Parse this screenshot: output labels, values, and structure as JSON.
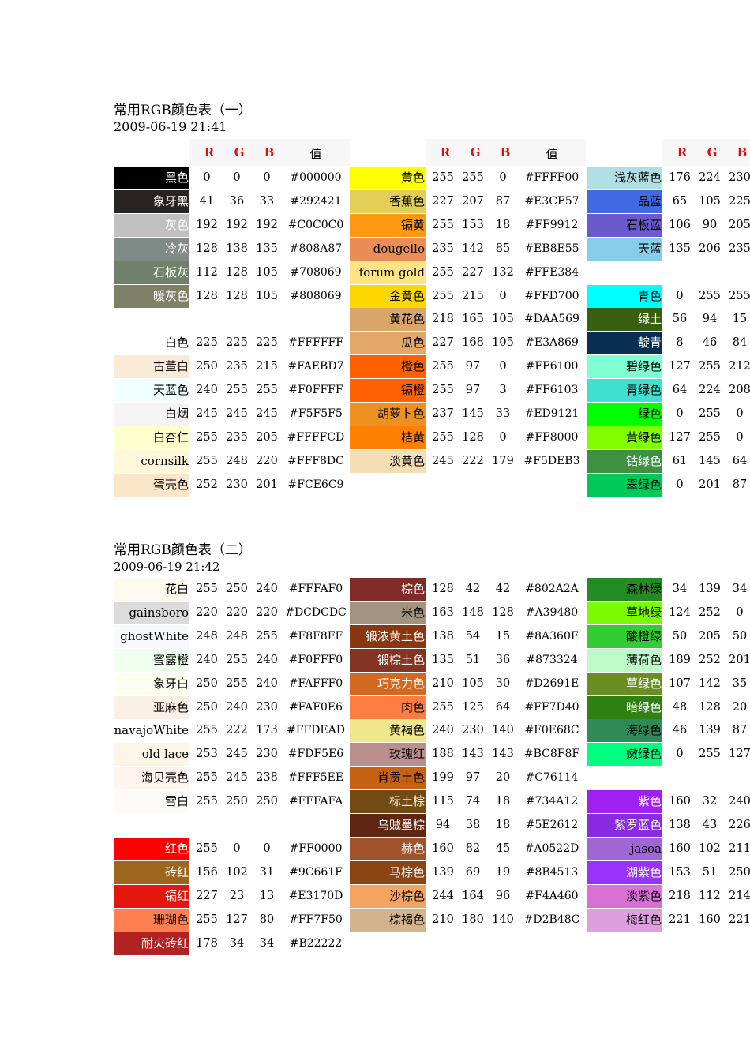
{
  "section1": {
    "title": "常用RGB颜色表（一）",
    "date": "2009-06-19 21:41",
    "header": {
      "r": "R",
      "g": "G",
      "b": "B",
      "value": "值"
    },
    "columns": [
      [
        {
          "name": "黑色",
          "r": "0",
          "g": "0",
          "b": "0",
          "hex": "#000000",
          "color": "#000000",
          "text": "#ffffff"
        },
        {
          "name": "象牙黑",
          "r": "41",
          "g": "36",
          "b": "33",
          "hex": "#292421",
          "color": "#292421",
          "text": "#ffffff"
        },
        {
          "name": "灰色",
          "r": "192",
          "g": "192",
          "b": "192",
          "hex": "#C0C0C0",
          "color": "#C0C0C0",
          "text": "#ffffff"
        },
        {
          "name": "冷灰",
          "r": "128",
          "g": "138",
          "b": "135",
          "hex": "#808A87",
          "color": "#808A87",
          "text": "#ffffff"
        },
        {
          "name": "石板灰",
          "r": "112",
          "g": "128",
          "b": "105",
          "hex": "#708069",
          "color": "#708069",
          "text": "#ffffff"
        },
        {
          "name": "暖灰色",
          "r": "128",
          "g": "128",
          "b": "105",
          "hex": "#808069",
          "color": "#808069",
          "text": "#ffffff"
        },
        null,
        {
          "name": "白色",
          "r": "225",
          "g": "225",
          "b": "225",
          "hex": "#FFFFFF",
          "color": "#FFFFFF",
          "text": "#000000"
        },
        {
          "name": "古董白",
          "r": "250",
          "g": "235",
          "b": "215",
          "hex": "#FAEBD7",
          "color": "#FAEBD7",
          "text": "#000000"
        },
        {
          "name": "天蓝色",
          "r": "240",
          "g": "255",
          "b": "255",
          "hex": "#F0FFFF",
          "color": "#F0FFFF",
          "text": "#000000"
        },
        {
          "name": "白烟",
          "r": "245",
          "g": "245",
          "b": "245",
          "hex": "#F5F5F5",
          "color": "#F5F5F5",
          "text": "#000000"
        },
        {
          "name": "白杏仁",
          "r": "255",
          "g": "235",
          "b": "205",
          "hex": "#FFFFCD",
          "color": "#FFFFCD",
          "text": "#000000"
        },
        {
          "name": "cornsilk",
          "r": "255",
          "g": "248",
          "b": "220",
          "hex": "#FFF8DC",
          "color": "#FFF8DC",
          "text": "#000000"
        },
        {
          "name": "蛋壳色",
          "r": "252",
          "g": "230",
          "b": "201",
          "hex": "#FCE6C9",
          "color": "#FCE6C9",
          "text": "#000000"
        }
      ],
      [
        {
          "name": "黄色",
          "r": "255",
          "g": "255",
          "b": "0",
          "hex": "#FFFF00",
          "color": "#FFFF00",
          "text": "#000000"
        },
        {
          "name": "香蕉色",
          "r": "227",
          "g": "207",
          "b": "87",
          "hex": "#E3CF57",
          "color": "#E3CF57",
          "text": "#000000"
        },
        {
          "name": "镉黄",
          "r": "255",
          "g": "153",
          "b": "18",
          "hex": "#FF9912",
          "color": "#FF9912",
          "text": "#000000"
        },
        {
          "name": "dougello",
          "r": "235",
          "g": "142",
          "b": "85",
          "hex": "#EB8E55",
          "color": "#EB8E55",
          "text": "#000000"
        },
        {
          "name": "forum gold",
          "r": "255",
          "g": "227",
          "b": "132",
          "hex": "#FFE384",
          "color": "#FFE384",
          "text": "#000000"
        },
        {
          "name": "金黄色",
          "r": "255",
          "g": "215",
          "b": "0",
          "hex": "#FFD700",
          "color": "#FFD700",
          "text": "#000000"
        },
        {
          "name": "黄花色",
          "r": "218",
          "g": "165",
          "b": "105",
          "hex": "#DAA569",
          "color": "#DAA569",
          "text": "#000000"
        },
        {
          "name": "瓜色",
          "r": "227",
          "g": "168",
          "b": "105",
          "hex": "#E3A869",
          "color": "#E3A869",
          "text": "#000000"
        },
        {
          "name": "橙色",
          "r": "255",
          "g": "97",
          "b": "0",
          "hex": "#FF6100",
          "color": "#FF6100",
          "text": "#000000"
        },
        {
          "name": "镉橙",
          "r": "255",
          "g": "97",
          "b": "3",
          "hex": "#FF6103",
          "color": "#FF6103",
          "text": "#000000"
        },
        {
          "name": "胡萝卜色",
          "r": "237",
          "g": "145",
          "b": "33",
          "hex": "#ED9121",
          "color": "#ED9121",
          "text": "#000000"
        },
        {
          "name": "桔黄",
          "r": "255",
          "g": "128",
          "b": "0",
          "hex": "#FF8000",
          "color": "#FF8000",
          "text": "#000000"
        },
        {
          "name": "淡黄色",
          "r": "245",
          "g": "222",
          "b": "179",
          "hex": "#F5DEB3",
          "color": "#F5DEB3",
          "text": "#000000"
        },
        null
      ],
      [
        {
          "name": "浅灰蓝色",
          "r": "176",
          "g": "224",
          "b": "230",
          "hex": "",
          "color": "#B0E0E6",
          "text": "#000000"
        },
        {
          "name": "品蓝",
          "r": "65",
          "g": "105",
          "b": "225",
          "hex": "",
          "color": "#4169E1",
          "text": "#000000"
        },
        {
          "name": "石板蓝",
          "r": "106",
          "g": "90",
          "b": "205",
          "hex": "",
          "color": "#6A5ACD",
          "text": "#000000"
        },
        {
          "name": "天蓝",
          "r": "135",
          "g": "206",
          "b": "235",
          "hex": "",
          "color": "#87CEEB",
          "text": "#000000"
        },
        null,
        {
          "name": "青色",
          "r": "0",
          "g": "255",
          "b": "255",
          "hex": "",
          "color": "#00FFFF",
          "text": "#000000"
        },
        {
          "name": "绿土",
          "r": "56",
          "g": "94",
          "b": "15",
          "hex": "",
          "color": "#385E0F",
          "text": "#ffffff"
        },
        {
          "name": "靛青",
          "r": "8",
          "g": "46",
          "b": "84",
          "hex": "",
          "color": "#082E54",
          "text": "#ffffff"
        },
        {
          "name": "碧绿色",
          "r": "127",
          "g": "255",
          "b": "212",
          "hex": "",
          "color": "#7FFFD4",
          "text": "#000000"
        },
        {
          "name": "青绿色",
          "r": "64",
          "g": "224",
          "b": "208",
          "hex": "",
          "color": "#40E0D0",
          "text": "#000000"
        },
        {
          "name": "绿色",
          "r": "0",
          "g": "255",
          "b": "0",
          "hex": "",
          "color": "#00FF00",
          "text": "#000000"
        },
        {
          "name": "黄绿色",
          "r": "127",
          "g": "255",
          "b": "0",
          "hex": "",
          "color": "#7FFF00",
          "text": "#000000"
        },
        {
          "name": "钴绿色",
          "r": "61",
          "g": "145",
          "b": "64",
          "hex": "",
          "color": "#3D9140",
          "text": "#ffffff"
        },
        {
          "name": "翠绿色",
          "r": "0",
          "g": "201",
          "b": "87",
          "hex": "",
          "color": "#00C957",
          "text": "#000000"
        }
      ]
    ]
  },
  "section2": {
    "title": "常用RGB颜色表（二）",
    "date": "2009-06-19 21:42",
    "columns": [
      [
        {
          "name": "花白",
          "r": "255",
          "g": "250",
          "b": "240",
          "hex": "#FFFAF0",
          "color": "#FFFAF0",
          "text": "#000000"
        },
        {
          "name": "gainsboro",
          "r": "220",
          "g": "220",
          "b": "220",
          "hex": "#DCDCDC",
          "color": "#DCDCDC",
          "text": "#000000"
        },
        {
          "name": "ghostWhite",
          "r": "248",
          "g": "248",
          "b": "255",
          "hex": "#F8F8FF",
          "color": "#F8F8FF",
          "text": "#000000"
        },
        {
          "name": "蜜露橙",
          "r": "240",
          "g": "255",
          "b": "240",
          "hex": "#F0FFF0",
          "color": "#F0FFF0",
          "text": "#000000"
        },
        {
          "name": "象牙白",
          "r": "250",
          "g": "255",
          "b": "240",
          "hex": "#FAFFF0",
          "color": "#FAFFF0",
          "text": "#000000"
        },
        {
          "name": "亚麻色",
          "r": "250",
          "g": "240",
          "b": "230",
          "hex": "#FAF0E6",
          "color": "#FAF0E6",
          "text": "#000000"
        },
        {
          "name": "navajoWhite",
          "r": "255",
          "g": "222",
          "b": "173",
          "hex": "#FFDEAD",
          "color": "#FFFFFF",
          "text": "#000000"
        },
        {
          "name": "old lace",
          "r": "253",
          "g": "245",
          "b": "230",
          "hex": "#FDF5E6",
          "color": "#FDF5E6",
          "text": "#000000"
        },
        {
          "name": "海贝壳色",
          "r": "255",
          "g": "245",
          "b": "238",
          "hex": "#FFF5EE",
          "color": "#FFF5EE",
          "text": "#000000"
        },
        {
          "name": "雪白",
          "r": "255",
          "g": "250",
          "b": "250",
          "hex": "#FFFAFA",
          "color": "#FFFAFA",
          "text": "#000000"
        },
        null,
        {
          "name": "红色",
          "r": "255",
          "g": "0",
          "b": "0",
          "hex": "#FF0000",
          "color": "#FF0000",
          "text": "#ffffff"
        },
        {
          "name": "砖红",
          "r": "156",
          "g": "102",
          "b": "31",
          "hex": "#9C661F",
          "color": "#9C661F",
          "text": "#ffffff"
        },
        {
          "name": "镉红",
          "r": "227",
          "g": "23",
          "b": "13",
          "hex": "#E3170D",
          "color": "#E3170D",
          "text": "#ffffff"
        },
        {
          "name": "珊瑚色",
          "r": "255",
          "g": "127",
          "b": "80",
          "hex": "#FF7F50",
          "color": "#FF7F50",
          "text": "#000000"
        },
        {
          "name": "耐火砖红",
          "r": "178",
          "g": "34",
          "b": "34",
          "hex": "#B22222",
          "color": "#B22222",
          "text": "#ffffff"
        }
      ],
      [
        {
          "name": "棕色",
          "r": "128",
          "g": "42",
          "b": "42",
          "hex": "#802A2A",
          "color": "#802A2A",
          "text": "#ffffff"
        },
        {
          "name": "米色",
          "r": "163",
          "g": "148",
          "b": "128",
          "hex": "#A39480",
          "color": "#A39480",
          "text": "#000000"
        },
        {
          "name": "锻浓黄土色",
          "r": "138",
          "g": "54",
          "b": "15",
          "hex": "#8A360F",
          "color": "#8A360F",
          "text": "#ffffff"
        },
        {
          "name": "锻棕土色",
          "r": "135",
          "g": "51",
          "b": "36",
          "hex": "#873324",
          "color": "#873324",
          "text": "#ffffff"
        },
        {
          "name": "巧克力色",
          "r": "210",
          "g": "105",
          "b": "30",
          "hex": "#D2691E",
          "color": "#D2691E",
          "text": "#ffffff"
        },
        {
          "name": "肉色",
          "r": "255",
          "g": "125",
          "b": "64",
          "hex": "#FF7D40",
          "color": "#FF7D40",
          "text": "#000000"
        },
        {
          "name": "黄褐色",
          "r": "240",
          "g": "230",
          "b": "140",
          "hex": "#F0E68C",
          "color": "#F0E68C",
          "text": "#000000"
        },
        {
          "name": "玫瑰红",
          "r": "188",
          "g": "143",
          "b": "143",
          "hex": "#BC8F8F",
          "color": "#BC8F8F",
          "text": "#000000"
        },
        {
          "name": "肖贡土色",
          "r": "199",
          "g": "97",
          "b": "20",
          "hex": "#C76114",
          "color": "#C76114",
          "text": "#000000"
        },
        {
          "name": "标土棕",
          "r": "115",
          "g": "74",
          "b": "18",
          "hex": "#734A12",
          "color": "#734A12",
          "text": "#ffffff"
        },
        {
          "name": "乌贼墨棕",
          "r": "94",
          "g": "38",
          "b": "18",
          "hex": "#5E2612",
          "color": "#5E2612",
          "text": "#ffffff"
        },
        {
          "name": "赫色",
          "r": "160",
          "g": "82",
          "b": "45",
          "hex": "#A0522D",
          "color": "#A0522D",
          "text": "#ffffff"
        },
        {
          "name": "马棕色",
          "r": "139",
          "g": "69",
          "b": "19",
          "hex": "#8B4513",
          "color": "#8B4513",
          "text": "#ffffff"
        },
        {
          "name": "沙棕色",
          "r": "244",
          "g": "164",
          "b": "96",
          "hex": "#F4A460",
          "color": "#F4A460",
          "text": "#000000"
        },
        {
          "name": "棕褐色",
          "r": "210",
          "g": "180",
          "b": "140",
          "hex": "#D2B48C",
          "color": "#D2B48C",
          "text": "#000000"
        },
        null
      ],
      [
        {
          "name": "森林绿",
          "r": "34",
          "g": "139",
          "b": "34",
          "hex": "",
          "color": "#228B22",
          "text": "#000000"
        },
        {
          "name": "草地绿",
          "r": "124",
          "g": "252",
          "b": "0",
          "hex": "",
          "color": "#7CFC00",
          "text": "#000000"
        },
        {
          "name": "酸橙绿",
          "r": "50",
          "g": "205",
          "b": "50",
          "hex": "",
          "color": "#32CD32",
          "text": "#000000"
        },
        {
          "name": "薄荷色",
          "r": "189",
          "g": "252",
          "b": "201",
          "hex": "",
          "color": "#BDFCC9",
          "text": "#000000"
        },
        {
          "name": "草绿色",
          "r": "107",
          "g": "142",
          "b": "35",
          "hex": "",
          "color": "#6B8E23",
          "text": "#ffffff"
        },
        {
          "name": "暗绿色",
          "r": "48",
          "g": "128",
          "b": "20",
          "hex": "",
          "color": "#308014",
          "text": "#ffffff"
        },
        {
          "name": "海绿色",
          "r": "46",
          "g": "139",
          "b": "87",
          "hex": "",
          "color": "#2E8B57",
          "text": "#000000"
        },
        {
          "name": "嫩绿色",
          "r": "0",
          "g": "255",
          "b": "127",
          "hex": "",
          "color": "#00FF7F",
          "text": "#000000"
        },
        null,
        {
          "name": "紫色",
          "r": "160",
          "g": "32",
          "b": "240",
          "hex": "",
          "color": "#A020F0",
          "text": "#ffffff"
        },
        {
          "name": "紫罗蓝色",
          "r": "138",
          "g": "43",
          "b": "226",
          "hex": "",
          "color": "#8A2BE2",
          "text": "#ffffff"
        },
        {
          "name": "jasoa",
          "r": "160",
          "g": "102",
          "b": "211",
          "hex": "",
          "color": "#A066D3",
          "text": "#000000"
        },
        {
          "name": "湖紫色",
          "r": "153",
          "g": "51",
          "b": "250",
          "hex": "",
          "color": "#9933FA",
          "text": "#ffffff"
        },
        {
          "name": "淡紫色",
          "r": "218",
          "g": "112",
          "b": "214",
          "hex": "",
          "color": "#DA70D6",
          "text": "#000000"
        },
        {
          "name": "梅红色",
          "r": "221",
          "g": "160",
          "b": "221",
          "hex": "",
          "color": "#DDA0DD",
          "text": "#000000"
        },
        null
      ]
    ]
  }
}
